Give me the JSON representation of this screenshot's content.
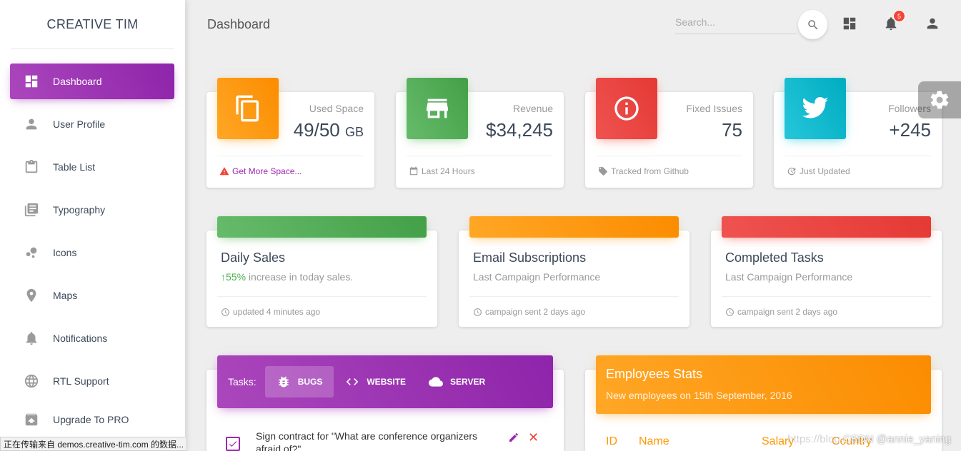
{
  "brand": {
    "logo_text": "CREATIVE TIM"
  },
  "sidebar": {
    "items": [
      {
        "label": "Dashboard",
        "icon": "dashboard-icon",
        "active": true
      },
      {
        "label": "User Profile",
        "icon": "person-icon"
      },
      {
        "label": "Table List",
        "icon": "clipboard-icon"
      },
      {
        "label": "Typography",
        "icon": "library-books-icon"
      },
      {
        "label": "Icons",
        "icon": "bubble-chart-icon"
      },
      {
        "label": "Maps",
        "icon": "location-pin-icon"
      },
      {
        "label": "Notifications",
        "icon": "bell-icon"
      },
      {
        "label": "RTL Support",
        "icon": "globe-icon"
      },
      {
        "label": "Upgrade To PRO",
        "icon": "unarchive-icon"
      }
    ]
  },
  "header": {
    "title": "Dashboard",
    "search_placeholder": "Search...",
    "notification_count": "5"
  },
  "stats": [
    {
      "label": "Used Space",
      "value": "49/50",
      "unit": "GB",
      "footer": "Get More Space...",
      "icon": "copy-icon",
      "color": "#ff9800"
    },
    {
      "label": "Revenue",
      "value": "$34,245",
      "footer": "Last 24 Hours",
      "icon": "store-icon",
      "color": "#4caf50"
    },
    {
      "label": "Fixed Issues",
      "value": "75",
      "footer": "Tracked from Github",
      "icon": "info-icon",
      "color": "#f44336"
    },
    {
      "label": "Followers",
      "value": "+245",
      "footer": "Just Updated",
      "icon": "twitter-icon",
      "color": "#00bcd4"
    }
  ],
  "charts": [
    {
      "title": "Daily Sales",
      "sub_highlight": "55%",
      "sub_text": " increase in today sales.",
      "footer": "updated 4 minutes ago",
      "color": "#4caf50"
    },
    {
      "title": "Email Subscriptions",
      "sub_text": "Last Campaign Performance",
      "footer": "campaign sent 2 days ago",
      "color": "#ff9800"
    },
    {
      "title": "Completed Tasks",
      "sub_text": "Last Campaign Performance",
      "footer": "campaign sent 2 days ago",
      "color": "#f44336"
    }
  ],
  "tasks": {
    "label": "Tasks:",
    "tabs": [
      {
        "label": "BUGS",
        "icon": "bug-icon",
        "active": true
      },
      {
        "label": "WEBSITE",
        "icon": "code-icon"
      },
      {
        "label": "SERVER",
        "icon": "cloud-icon"
      }
    ],
    "rows": [
      {
        "text": "Sign contract for \"What are conference organizers afraid of?\"",
        "checked": true
      }
    ]
  },
  "employees": {
    "title": "Employees Stats",
    "subtitle": "New employees on 15th September, 2016",
    "columns": [
      "ID",
      "Name",
      "Salary",
      "Country"
    ]
  },
  "statusbar": {
    "text": "正在传输来自 demos.creative-tim.com 的数据..."
  },
  "watermark": {
    "text": "CSDN @annie_yaning",
    "faint": "https://blog."
  }
}
